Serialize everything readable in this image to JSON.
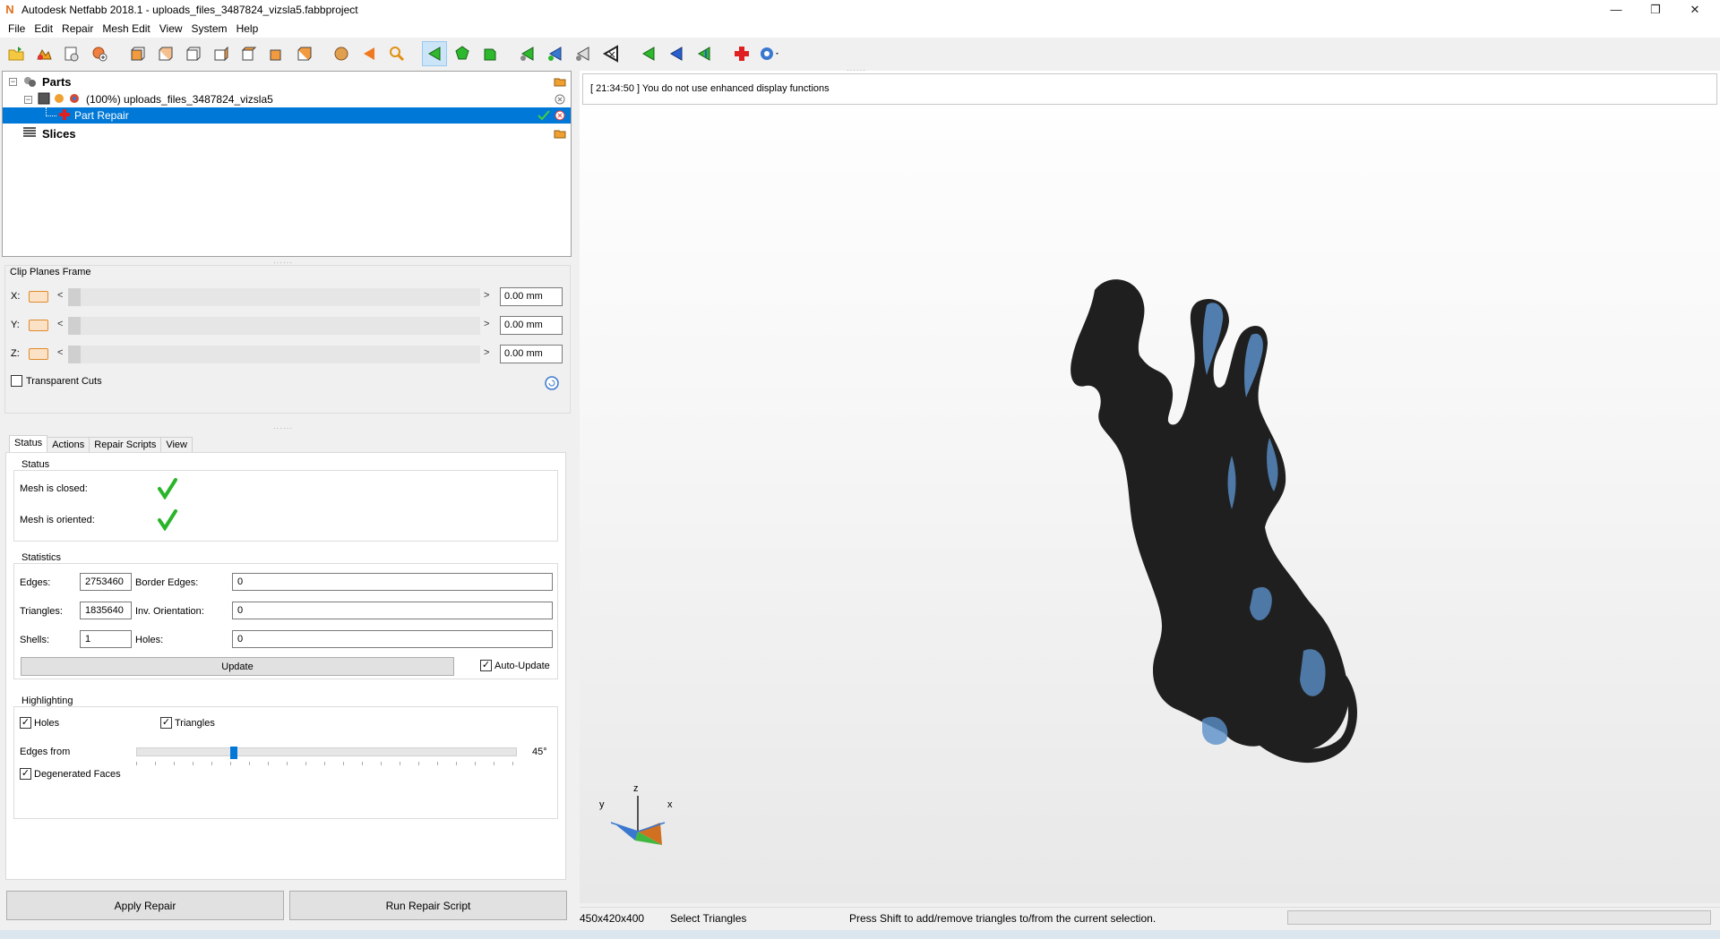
{
  "window": {
    "title": "Autodesk Netfabb 2018.1 - uploads_files_3487824_vizsla5.fabbproject",
    "logo": "N",
    "controls": {
      "minimize": "—",
      "maximize": "❐",
      "close": "✕"
    }
  },
  "menu": [
    "File",
    "Edit",
    "Repair",
    "Mesh Edit",
    "View",
    "System",
    "Help"
  ],
  "toolbar": {
    "icons": [
      "open-project-icon",
      "add-part-icon",
      "new-project-icon",
      "add-with-options-icon",
      "view-front-icon",
      "view-back-icon",
      "view-left-icon",
      "view-right-icon",
      "view-top-icon",
      "view-bottom-icon",
      "view-iso-icon",
      "shading-icon",
      "undo-view-icon",
      "zoom-icon",
      "select-triangles-icon",
      "select-surfaces-icon",
      "select-shells-icon",
      "add-triangle-icon",
      "mark-icon",
      "unmark-icon",
      "remove-icon",
      "prev-icon",
      "next-icon",
      "back-icon",
      "repair-icon",
      "help-icon"
    ]
  },
  "tree": {
    "parts_label": "Parts",
    "part_name": "(100%) uploads_files_3487824_vizsla5",
    "repair_label": "Part Repair",
    "slices_label": "Slices"
  },
  "clip": {
    "title": "Clip Planes Frame",
    "rows": [
      {
        "axis": "X:",
        "value": "0.00 mm"
      },
      {
        "axis": "Y:",
        "value": "0.00 mm"
      },
      {
        "axis": "Z:",
        "value": "0.00 mm"
      }
    ],
    "lt": "<",
    "gt": ">",
    "transparent_label": "Transparent Cuts"
  },
  "tabs": [
    "Status",
    "Actions",
    "Repair Scripts",
    "View"
  ],
  "status": {
    "title": "Status",
    "closed_label": "Mesh is closed:",
    "oriented_label": "Mesh is oriented:"
  },
  "statistics": {
    "title": "Statistics",
    "edges_label": "Edges:",
    "edges": "2753460",
    "border_edges_label": "Border Edges:",
    "border_edges": "0",
    "triangles_label": "Triangles:",
    "triangles": "1835640",
    "inv_orientation_label": "Inv. Orientation:",
    "inv_orientation": "0",
    "shells_label": "Shells:",
    "shells": "1",
    "holes_label": "Holes:",
    "holes": "0",
    "update_label": "Update",
    "auto_update_label": "Auto-Update"
  },
  "highlighting": {
    "title": "Highlighting",
    "holes_label": "Holes",
    "triangles_label": "Triangles",
    "edges_from_label": "Edges from",
    "edges_angle": "45°",
    "edges_slider_fraction": 0.25,
    "degenerated_label": "Degenerated Faces"
  },
  "buttons": {
    "apply_repair": "Apply Repair",
    "run_repair_script": "Run Repair Script"
  },
  "log": {
    "message": "[ 21:34:50 ] You do not use enhanced display functions"
  },
  "axis": {
    "x": "x",
    "y": "y",
    "z": "z"
  },
  "statusbar": {
    "dimensions": "450x420x400",
    "mode": "Select Triangles",
    "hint": "Press Shift to add/remove triangles to/from the current selection."
  },
  "colors": {
    "selection": "#0078d7",
    "model": "#1f1f1f",
    "highlight": "#5a8fc8"
  }
}
